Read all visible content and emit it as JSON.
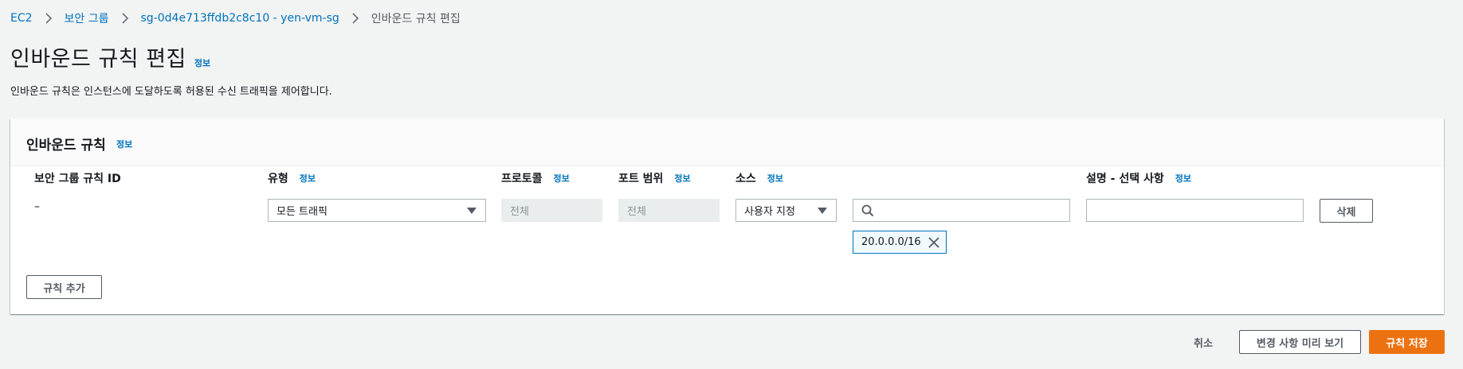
{
  "breadcrumb": {
    "items": [
      "EC2",
      "보안 그룹",
      "sg-0d4e713ffdb2c8c10 - yen-vm-sg"
    ],
    "current": "인바운드 규칙 편집"
  },
  "page": {
    "title": "인바운드 규칙 편집",
    "info": "정보",
    "description": "인바운드 규칙은 인스턴스에 도달하도록 허용된 수신 트래픽을 제어합니다."
  },
  "rules": {
    "title": "인바운드 규칙",
    "info": "정보",
    "columns": {
      "rule_id": "보안 그룹 규칙 ID",
      "type": "유형",
      "protocol": "프로토콜",
      "port_range": "포트 범위",
      "source": "소스",
      "description": "설명 - 선택 사항",
      "info": "정보"
    },
    "row": {
      "rule_id": "–",
      "type": "모든 트래픽",
      "protocol": "전체",
      "port_range": "전체",
      "source_type": "사용자 지정",
      "source_search_value": "",
      "source_token": "20.0.0.0/16",
      "description_value": "",
      "delete_label": "삭제"
    },
    "add_rule_label": "규칙 추가"
  },
  "footer": {
    "cancel_label": "취소",
    "preview_label": "변경 사항 미리 보기",
    "save_label": "규칙 저장"
  },
  "colors": {
    "link": "#0073bb",
    "primary": "#ec7211",
    "background": "#f2f3f3"
  }
}
